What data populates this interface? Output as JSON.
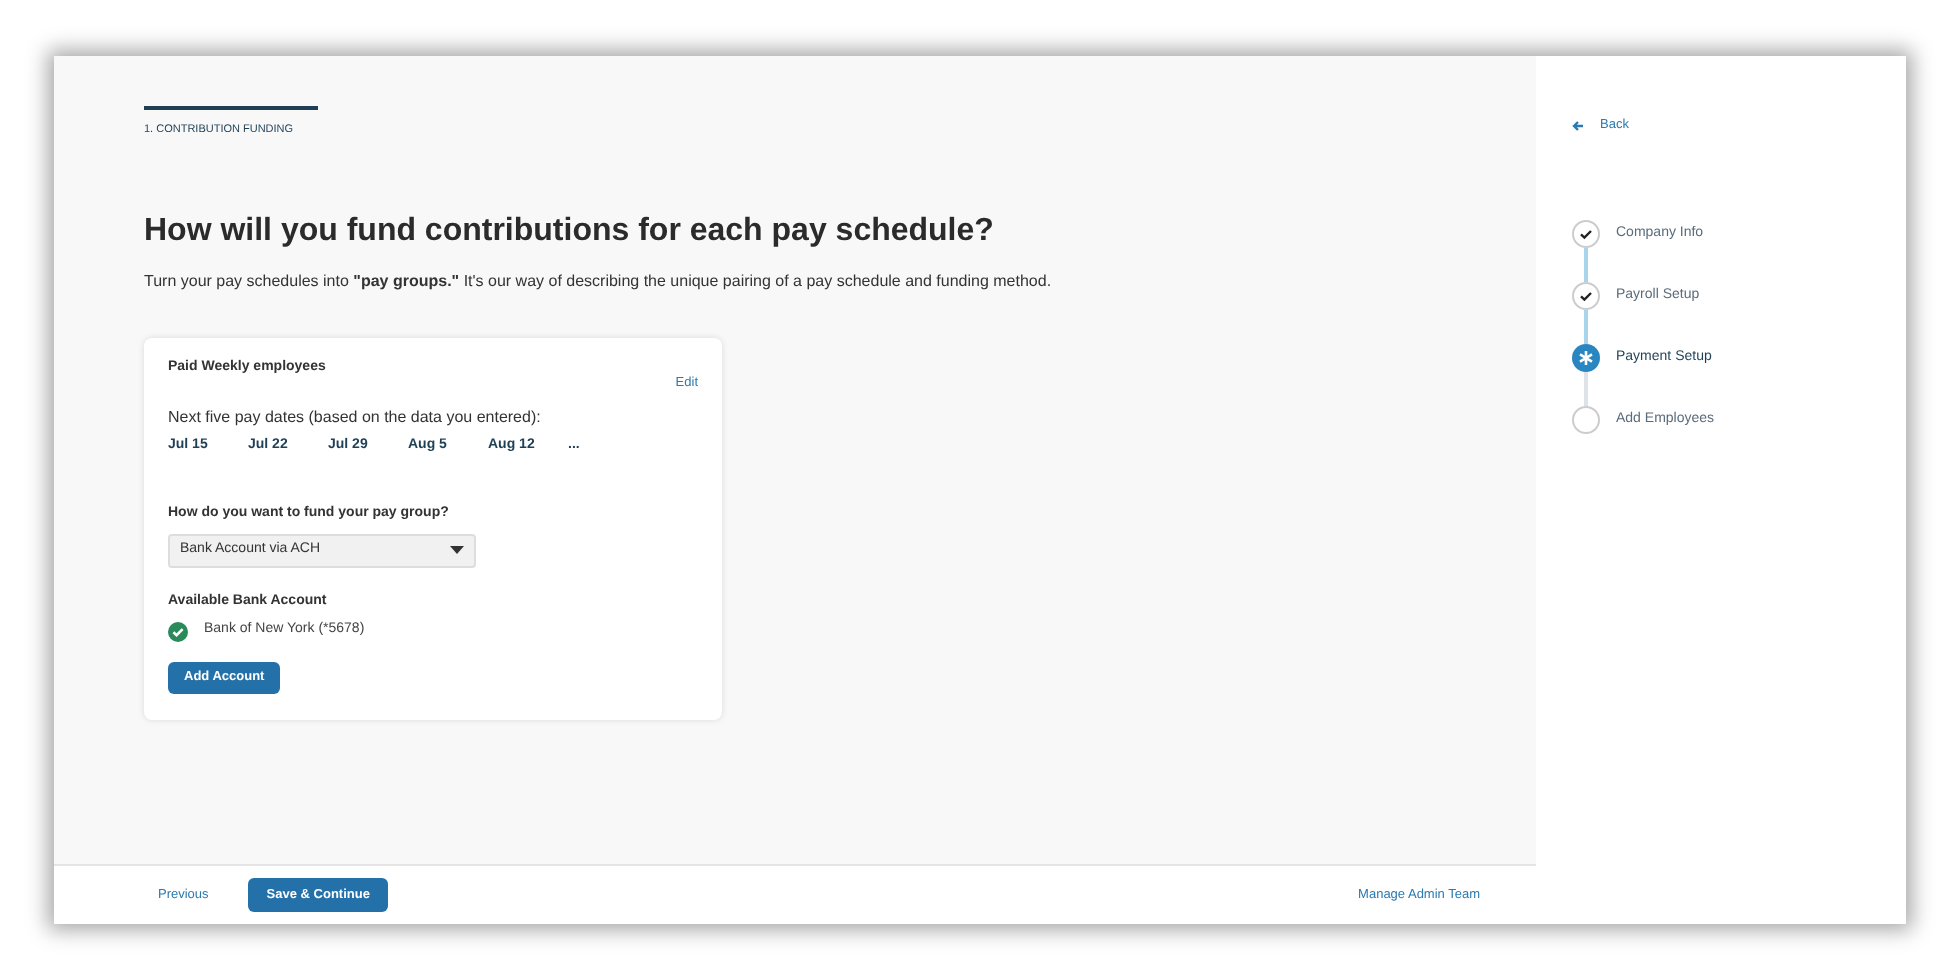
{
  "section_label": "1. CONTRIBUTION FUNDING",
  "heading": "How will you fund contributions for each pay schedule?",
  "intro": "Turn your pay schedules into **\"pay groups.\"** It's our way of describing the unique pairing of a pay schedule and funding method.",
  "pay_group": {
    "title": "Paid Weekly employees",
    "edit_link": "Edit",
    "dates_label": "Next five pay dates (based on the data you entered):",
    "dates": [
      "Jul 15",
      "Jul 22",
      "Jul 29",
      "Aug 5",
      "Aug 12",
      "..."
    ],
    "fund_question": "How do you want to fund your pay group?",
    "fund_select": "Bank Account via ACH",
    "bank_heading": "Available Bank Account",
    "bank_account": {
      "name": "Bank of New York (*5678)",
      "verified": true
    },
    "add_button": "Add Account"
  },
  "footer": {
    "previous": "Previous",
    "save": "Save & Continue",
    "manage": "Manage Admin Team"
  },
  "sidebar": {
    "back": "Back",
    "steps": [
      {
        "label": "Company Info",
        "completed": true,
        "selected": false
      },
      {
        "label": "Payroll Setup",
        "completed": true,
        "selected": false
      },
      {
        "label": "Payment Setup",
        "completed": false,
        "selected": true
      },
      {
        "label": "Add Employees",
        "completed": false,
        "selected": false
      }
    ]
  }
}
